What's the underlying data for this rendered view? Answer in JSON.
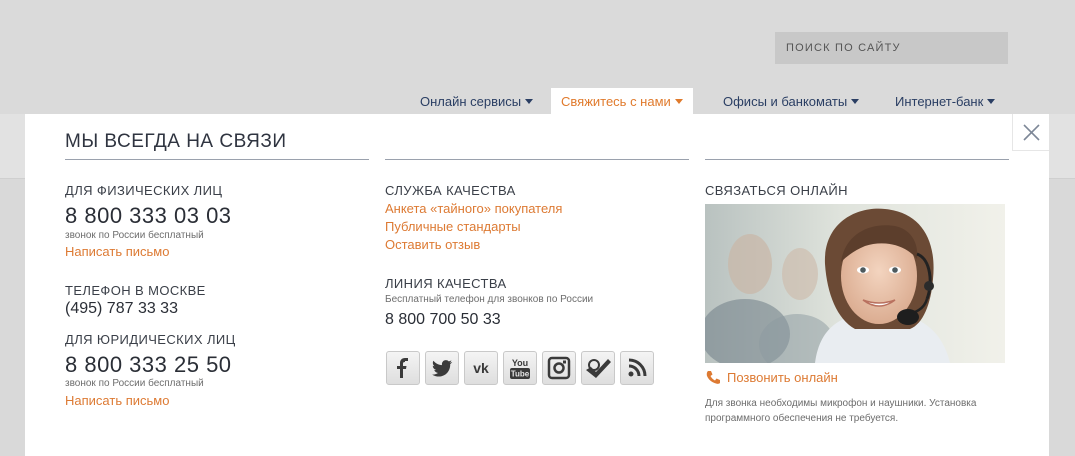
{
  "search": {
    "placeholder": "ПОИСК ПО САЙТУ"
  },
  "nav": [
    {
      "label": "Онлайн сервисы"
    },
    {
      "label": "Свяжитесь с нами"
    },
    {
      "label": "Офисы и банкоматы"
    },
    {
      "label": "Интернет-банк"
    }
  ],
  "panel": {
    "title": "МЫ ВСЕГДА НА СВЯЗИ",
    "individuals": {
      "label": "ДЛЯ ФИЗИЧЕСКИХ ЛИЦ",
      "phone": "8 800 333 03 03",
      "note": "звонок по России бесплатный",
      "link": "Написать письмо"
    },
    "moscow": {
      "label": "ТЕЛЕФОН В МОСКВЕ",
      "phone": "(495) 787 33 33"
    },
    "legal": {
      "label": "ДЛЯ ЮРИДИЧЕСКИХ ЛИЦ",
      "phone": "8 800 333 25 50",
      "note": "звонок по России бесплатный",
      "link": "Написать письмо"
    },
    "quality_service": {
      "label": "СЛУЖБА КАЧЕСТВА",
      "links": [
        "Анкета «тайного» покупателя",
        "Публичные стандарты",
        "Оставить отзыв"
      ]
    },
    "quality_line": {
      "label": "ЛИНИЯ КАЧЕСТВА",
      "note": "Бесплатный телефон для звонков по России",
      "phone": "8 800 700 50 33"
    },
    "social": [
      "facebook-icon",
      "twitter-icon",
      "vk-icon",
      "youtube-icon",
      "instagram-icon",
      "foursquare-icon",
      "rss-icon"
    ],
    "online": {
      "label": "СВЯЗАТЬСЯ ОНЛАЙН",
      "call_link": "Позвонить онлайн",
      "note_line1": "Для звонка необходимы микрофон и наушники. Установка",
      "note_line2": "программного обеспечения не требуется."
    }
  },
  "colors": {
    "accent": "#dd7a33",
    "nav": "#2a3e63"
  }
}
